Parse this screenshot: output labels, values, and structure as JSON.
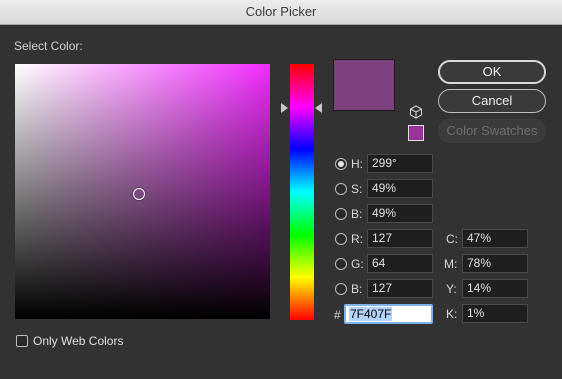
{
  "window": {
    "title": "Color Picker"
  },
  "picker": {
    "select_label": "Select Color:"
  },
  "buttons": {
    "ok": "OK",
    "cancel": "Cancel",
    "swatches": "Color Swatches"
  },
  "hsb": [
    {
      "label": "H:",
      "value": "299°",
      "selected": true
    },
    {
      "label": "S:",
      "value": "49%",
      "selected": false
    },
    {
      "label": "B:",
      "value": "49%",
      "selected": false
    }
  ],
  "rgb": [
    {
      "label": "R:",
      "value": "127",
      "selected": false
    },
    {
      "label": "G:",
      "value": "64",
      "selected": false
    },
    {
      "label": "B:",
      "value": "127",
      "selected": false
    }
  ],
  "cmyk": [
    {
      "label": "C:",
      "value": "47%"
    },
    {
      "label": "M:",
      "value": "78%"
    },
    {
      "label": "Y:",
      "value": "14%"
    },
    {
      "label": "K:",
      "value": "1%"
    }
  ],
  "hex": {
    "symbol": "#",
    "value": "7F407F"
  },
  "options": {
    "only_web_colors": "Only Web Colors"
  },
  "colors": {
    "current": "#7F407F",
    "websafe": "#993399",
    "hue_base": "#F22BFF"
  }
}
